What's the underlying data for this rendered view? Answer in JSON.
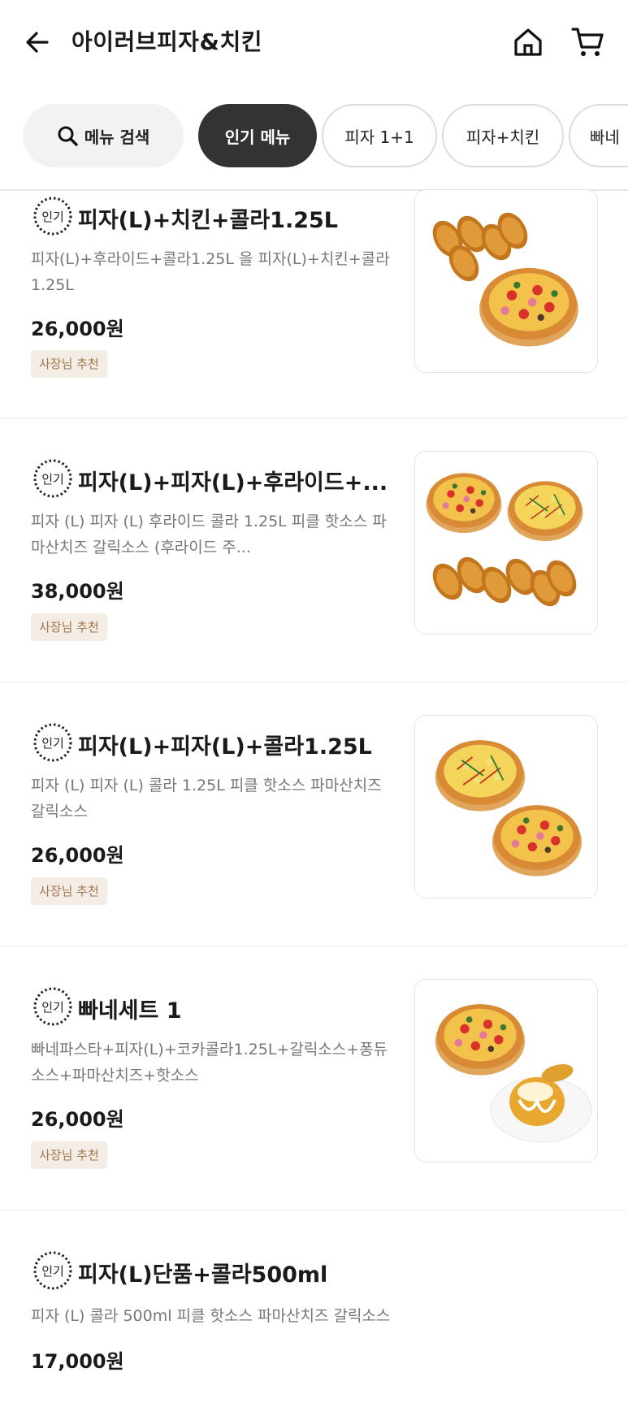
{
  "header": {
    "title": "아이러브피자&치킨"
  },
  "chips": {
    "search_label": "메뉴 검색",
    "items": [
      "인기 메뉴",
      "피자 1+1",
      "피자+치킨",
      "빠네"
    ]
  },
  "menu": {
    "badge_label": "인기",
    "items": [
      {
        "name": "피자(L)+치킨+콜라1.25L",
        "desc": "피자(L)+후라이드+콜라1.25L 을 피자(L)+치킨+콜라1.25L",
        "price": "26,000원",
        "tag": "사장님 추천",
        "image": "pizza-chicken-image"
      },
      {
        "name": "피자(L)+피자(L)+후라이드+...",
        "desc": "피자 (L) 피자 (L) 후라이드 콜라 1.25L 피클 핫소스 파마산치즈 갈릭소스 (후라이드 주...",
        "price": "38,000원",
        "tag": "사장님 추천",
        "image": "two-pizza-chicken-image"
      },
      {
        "name": "피자(L)+피자(L)+콜라1.25L",
        "desc": "피자 (L) 피자 (L) 콜라 1.25L 피클 핫소스 파마산치즈 갈릭소스",
        "price": "26,000원",
        "tag": "사장님 추천",
        "image": "two-pizza-image"
      },
      {
        "name": "빠네세트 1",
        "desc": "빠네파스타+피자(L)+코카콜라1.25L+갈릭소스+퐁듀소스+파마산치즈+핫소스",
        "price": "26,000원",
        "tag": "사장님 추천",
        "image": "pizza-pane-image"
      },
      {
        "name": "피자(L)단품+콜라500ml",
        "desc": "피자 (L) 콜라 500ml 피클 핫소스 파마산치즈 갈릭소스",
        "price": "17,000원"
      }
    ]
  },
  "colors": {
    "chip_active_bg": "#333333",
    "chip_search_bg": "#f2f2f2",
    "tag_bg": "#f4ede6",
    "tag_text": "#a1754c",
    "desc_text": "#777777"
  }
}
